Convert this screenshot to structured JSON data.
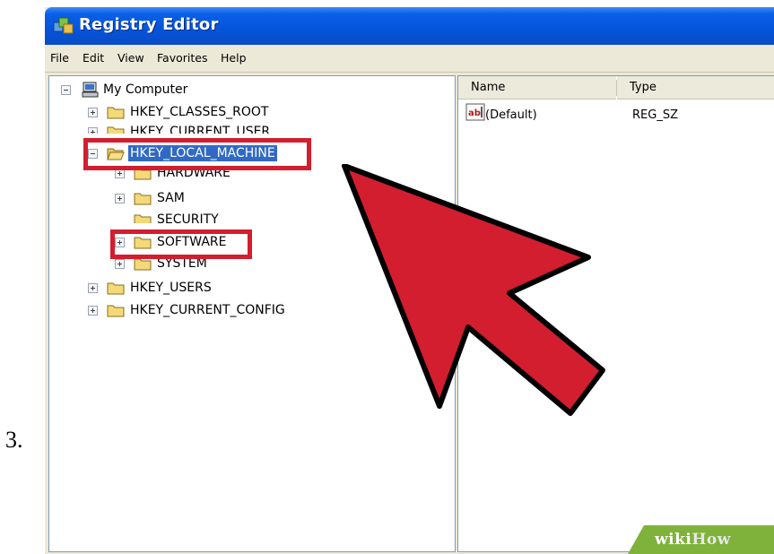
{
  "step_number": "3.",
  "window": {
    "title": "Registry Editor",
    "title_icon": "regedit-icon"
  },
  "menu": [
    {
      "label": "File"
    },
    {
      "label": "Edit"
    },
    {
      "label": "View"
    },
    {
      "label": "Favorites"
    },
    {
      "label": "Help"
    }
  ],
  "tree": {
    "root": {
      "label": "My Computer",
      "icon": "computer-icon",
      "expanded": true
    },
    "items": [
      {
        "label": "HKEY_CLASSES_ROOT",
        "expander": "plus"
      },
      {
        "label": "HKEY_CURRENT_USER",
        "expander": "plus"
      },
      {
        "label": "HKEY_LOCAL_MACHINE",
        "expander": "minus",
        "selected": true,
        "folder": "open"
      },
      {
        "label": "HARDWARE",
        "expander": "plus"
      },
      {
        "label": "SAM",
        "expander": "plus"
      },
      {
        "label": "SECURITY",
        "expander": "none"
      },
      {
        "label": "SOFTWARE",
        "expander": "plus"
      },
      {
        "label": "SYSTEM",
        "expander": "plus"
      },
      {
        "label": "HKEY_USERS",
        "expander": "plus"
      },
      {
        "label": "HKEY_CURRENT_CONFIG",
        "expander": "plus"
      }
    ]
  },
  "list": {
    "columns": [
      {
        "label": "Name"
      },
      {
        "label": "Type"
      }
    ],
    "rows": [
      {
        "name": "(Default)",
        "type": "REG_SZ",
        "icon": "string-value-icon"
      }
    ]
  },
  "annotations": {
    "highlight_color": "#d21e2f",
    "arrow_color": "#d21e2f"
  },
  "watermark": {
    "part1": "wiki",
    "part2": "How"
  },
  "colors": {
    "titlebar": "#0454d9",
    "selection": "#316ac5",
    "window_face": "#ece9d8"
  }
}
